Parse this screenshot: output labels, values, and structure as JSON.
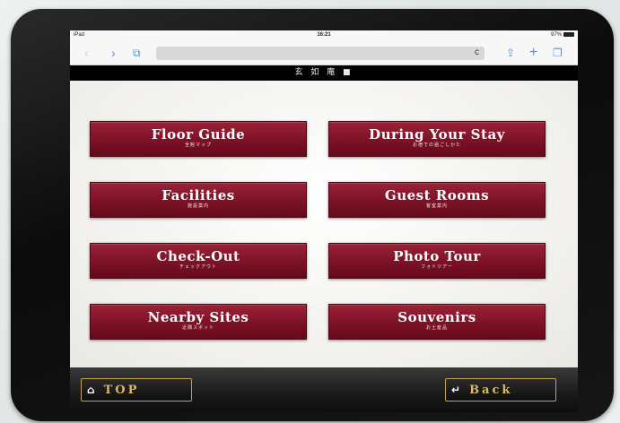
{
  "status": {
    "device": "iPad",
    "time": "16:21",
    "battery": "97%"
  },
  "toolbar": {
    "back_glyph": "‹",
    "forward_glyph": "›",
    "bookmarks_glyph": "⧉",
    "reload_glyph": "c",
    "share_glyph": "⇪",
    "add_glyph": "+",
    "tabs_glyph": "❐"
  },
  "logo": {
    "text": "玄 如 庵 ■"
  },
  "menu": {
    "floor_guide": {
      "label": "Floor Guide",
      "sub": "全館マップ"
    },
    "during_stay": {
      "label": "During Your Stay",
      "sub": "お宿での過ごしかた"
    },
    "facilities": {
      "label": "Facilities",
      "sub": "施設案内"
    },
    "guest_rooms": {
      "label": "Guest Rooms",
      "sub": "客室案内"
    },
    "check_out": {
      "label": "Check-Out",
      "sub": "チェックアウト"
    },
    "photo_tour": {
      "label": "Photo Tour",
      "sub": "フォトツアー"
    },
    "nearby_sites": {
      "label": "Nearby Sites",
      "sub": "近隣スポット"
    },
    "souvenirs": {
      "label": "Souvenirs",
      "sub": "お土産品"
    }
  },
  "nav": {
    "top_label": "TOP",
    "back_label": "Back",
    "home_glyph": "⌂",
    "return_glyph": "↵"
  },
  "colors": {
    "button_red": "#7c1226",
    "gold": "#c4a250",
    "bar_black": "#000000"
  },
  "icons": [
    "home-icon",
    "return-arrow-icon",
    "share-icon",
    "bookmarks-icon"
  ]
}
